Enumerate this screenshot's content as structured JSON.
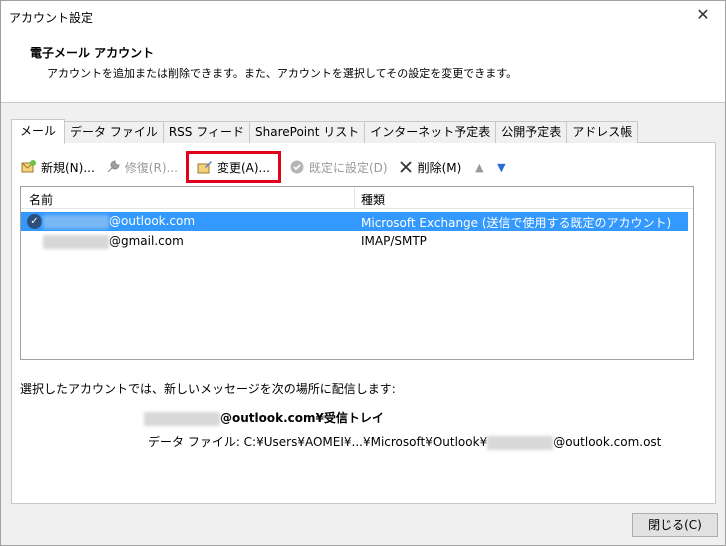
{
  "window": {
    "title": "アカウント設定",
    "close_glyph": "✕"
  },
  "header": {
    "title": "電子メール アカウント",
    "description": "アカウントを追加または削除できます。また、アカウントを選択してその設定を変更できます。"
  },
  "tabs": [
    {
      "label": "メール"
    },
    {
      "label": "データ ファイル"
    },
    {
      "label": "RSS フィード"
    },
    {
      "label": "SharePoint リスト"
    },
    {
      "label": "インターネット予定表"
    },
    {
      "label": "公開予定表"
    },
    {
      "label": "アドレス帳"
    }
  ],
  "toolbar": {
    "new_label": "新規(N)...",
    "repair_label": "修復(R)...",
    "change_label": "変更(A)...",
    "default_label": "既定に設定(D)",
    "delete_label": "削除(M)"
  },
  "list": {
    "col_name": "名前",
    "col_type": "種類",
    "rows": [
      {
        "name": "@outlook.com",
        "type": "Microsoft Exchange (送信で使用する既定のアカウント)"
      },
      {
        "name": "@gmail.com",
        "type": "IMAP/SMTP"
      }
    ]
  },
  "delivery": {
    "label": "選択したアカウントでは、新しいメッセージを次の場所に配信します:",
    "target": "@outlook.com¥受信トレイ",
    "datafile_prefix": "データ ファイル: C:¥Users¥AOMEI¥...¥Microsoft¥Outlook¥",
    "datafile_suffix": "@outlook.com.ost"
  },
  "buttons": {
    "close_label": "閉じる(C)"
  },
  "colors": {
    "selected_row": "#3399ff",
    "highlight_border": "#e2001a"
  }
}
